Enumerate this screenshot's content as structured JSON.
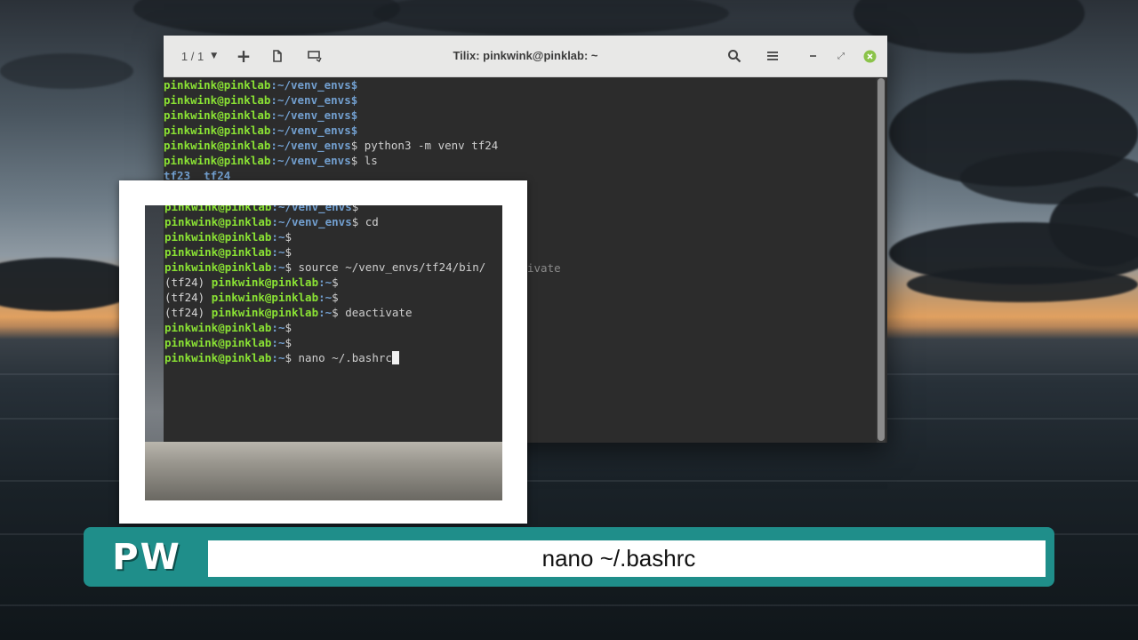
{
  "window": {
    "title": "Tilix: pinkwink@pinklab: ~",
    "session_counter": "1 / 1"
  },
  "terminal": {
    "lines": [
      {
        "user": "pinkwink@pinklab",
        "path": ":~/venv_envs",
        "cmd": "$"
      },
      {
        "user": "pinkwink@pinklab",
        "path": ":~/venv_envs",
        "cmd": "$"
      },
      {
        "user": "pinkwink@pinklab",
        "path": ":~/venv_envs",
        "cmd": "$"
      },
      {
        "user": "pinkwink@pinklab",
        "path": ":~/venv_envs",
        "cmd": "$"
      },
      {
        "user": "pinkwink@pinklab",
        "path": ":~/venv_envs",
        "cmd": "$ python3 -m venv tf24"
      },
      {
        "user": "pinkwink@pinklab",
        "path": ":~/venv_envs",
        "cmd": "$ ls"
      },
      {
        "output": "tf23  tf24"
      }
    ]
  },
  "inset": {
    "lines": [
      {
        "prefix": "",
        "user": "pinkwink@pinklab",
        "path": ":~/venv_envs",
        "cmd": "$"
      },
      {
        "prefix": "",
        "user": "pinkwink@pinklab",
        "path": ":~/venv_envs",
        "cmd": "$ cd"
      },
      {
        "prefix": "",
        "user": "pinkwink@pinklab",
        "path": ":~",
        "cmd": "$"
      },
      {
        "prefix": "",
        "user": "pinkwink@pinklab",
        "path": ":~",
        "cmd": "$"
      },
      {
        "prefix": "",
        "user": "pinkwink@pinklab",
        "path": ":~",
        "cmd": "$ source ~/venv_envs/tf24/bin/"
      },
      {
        "prefix": "(tf24) ",
        "user": "pinkwink@pinklab",
        "path": ":~",
        "cmd": "$"
      },
      {
        "prefix": "(tf24) ",
        "user": "pinkwink@pinklab",
        "path": ":~",
        "cmd": "$"
      },
      {
        "prefix": "(tf24) ",
        "user": "pinkwink@pinklab",
        "path": ":~",
        "cmd": "$ deactivate"
      },
      {
        "prefix": "",
        "user": "pinkwink@pinklab",
        "path": ":~",
        "cmd": "$"
      },
      {
        "prefix": "",
        "user": "pinkwink@pinklab",
        "path": ":~",
        "cmd": "$"
      },
      {
        "prefix": "",
        "user": "pinkwink@pinklab",
        "path": ":~",
        "cmd": "$ nano ~/.bashrc"
      }
    ],
    "overflow_text": "ivate"
  },
  "caption": {
    "logo": "PW",
    "text": "nano ~/.bashrc"
  },
  "colors": {
    "user": "#8ae234",
    "path": "#729fcf",
    "caption_teal": "#1f8e8a"
  },
  "icons": [
    "chevron-down-icon",
    "plus-icon",
    "new-window-icon",
    "sync-input-icon",
    "search-icon",
    "menu-icon",
    "minimize-icon",
    "maximize-icon",
    "close-icon"
  ]
}
